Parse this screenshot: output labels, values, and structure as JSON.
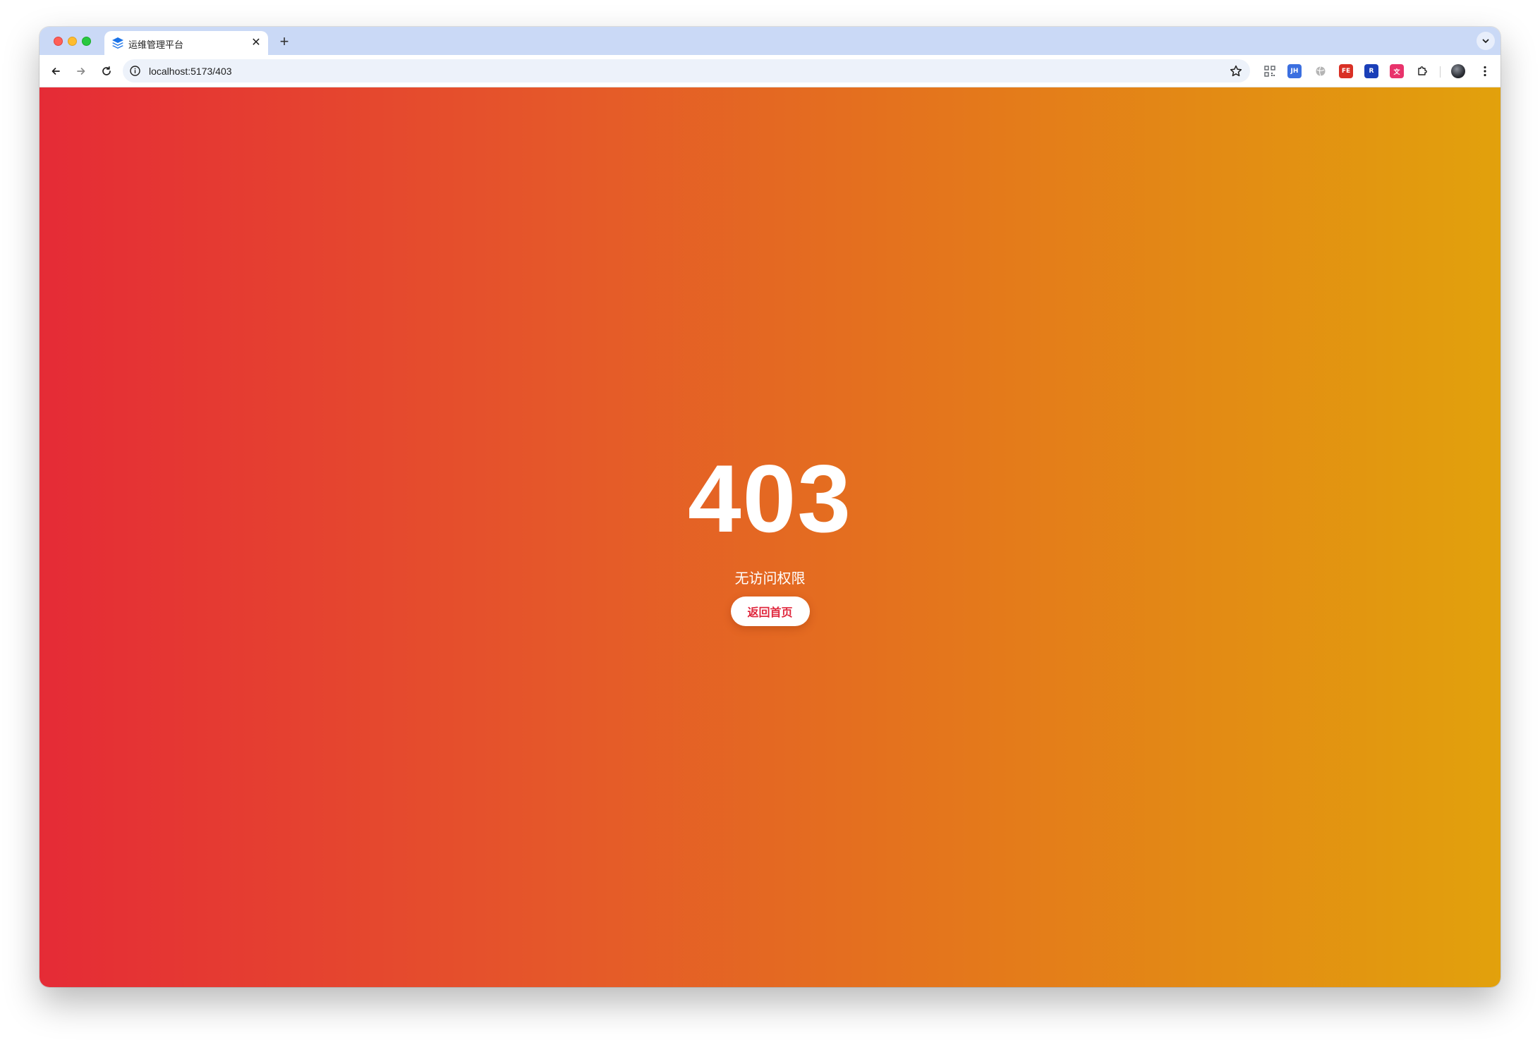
{
  "browser": {
    "tab": {
      "title": "运维管理平台",
      "favicon": "layers-icon",
      "close_glyph": "✕"
    },
    "new_tab_glyph": "+",
    "address_bar": {
      "url": "localhost:5173/403"
    },
    "extensions": [
      {
        "name": "qr-code-extension-icon",
        "label": "",
        "color": "#5f6368"
      },
      {
        "name": "jh-extension-icon",
        "label": "JH",
        "color": "#3b6fe0"
      },
      {
        "name": "globe-extension-icon",
        "label": "",
        "color": "#8a8a8a"
      },
      {
        "name": "fe-extension-icon",
        "label": "FE",
        "color": "#d93025"
      },
      {
        "name": "r-extension-icon",
        "label": "R",
        "color": "#1a3fb8"
      },
      {
        "name": "translate-extension-icon",
        "label": "文",
        "color": "#e8336b"
      }
    ]
  },
  "page": {
    "error_code": "403",
    "message": "无访问权限",
    "home_button_label": "返回首页",
    "colors": {
      "gradient_start": "#e52b36",
      "gradient_end": "#e2a10c",
      "button_text": "#e0283e"
    }
  }
}
